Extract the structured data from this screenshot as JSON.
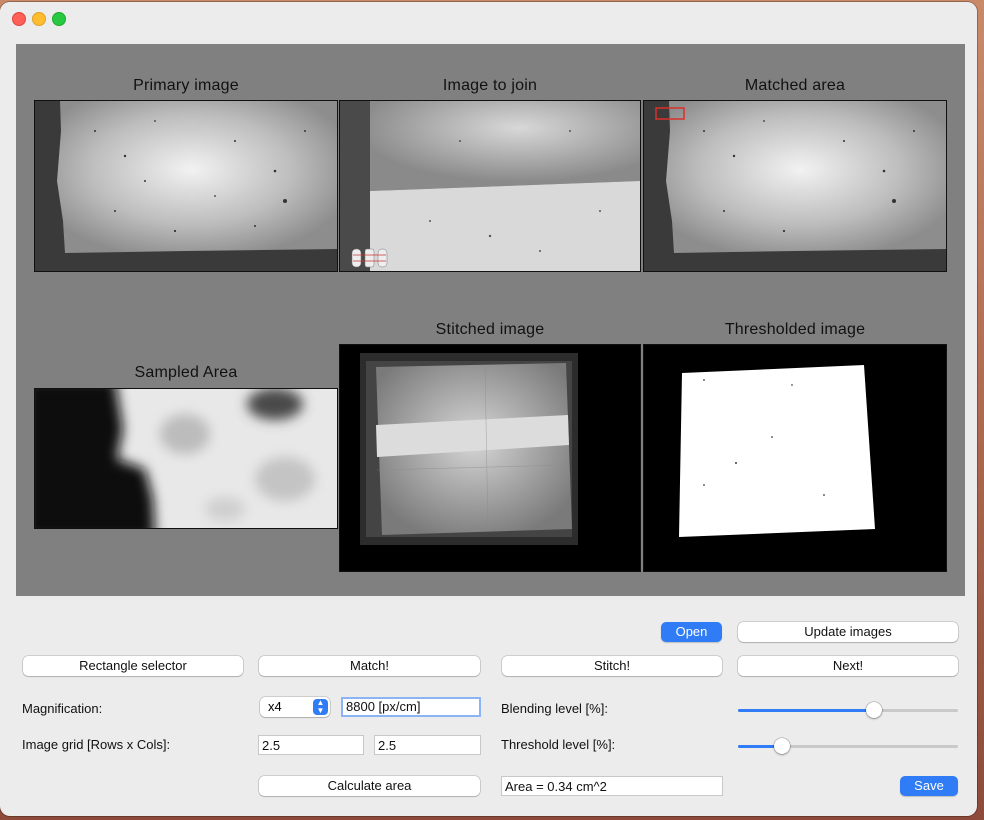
{
  "window": {
    "title": ""
  },
  "figure": {
    "panels": {
      "primary": "Primary image",
      "join": "Image to join",
      "matched": "Matched area",
      "sampled": "Sampled Area",
      "stitched": "Stitched image",
      "thresholded": "Thresholded image"
    }
  },
  "controls": {
    "open_label": "Open",
    "update_label": "Update images",
    "rect_selector_label": "Rectangle selector",
    "match_label": "Match!",
    "stitch_label": "Stitch!",
    "next_label": "Next!",
    "magnification_label": "Magnification:",
    "magnification_value": "x4",
    "px_per_cm_value": "8800 [px/cm]",
    "blending_label": "Blending level [%]:",
    "blending_value": 62,
    "grid_label": "Image grid [Rows x Cols]:",
    "grid_rows": "2.5",
    "grid_cols": "2.5",
    "threshold_label": "Threshold level [%]:",
    "threshold_value": 20,
    "calc_area_label": "Calculate area",
    "area_value": "Area = 0.34 cm^2",
    "save_label": "Save"
  },
  "colors": {
    "accent": "#2f7cf6",
    "figure_bg": "#808080",
    "match_rect": "#d9312a"
  }
}
